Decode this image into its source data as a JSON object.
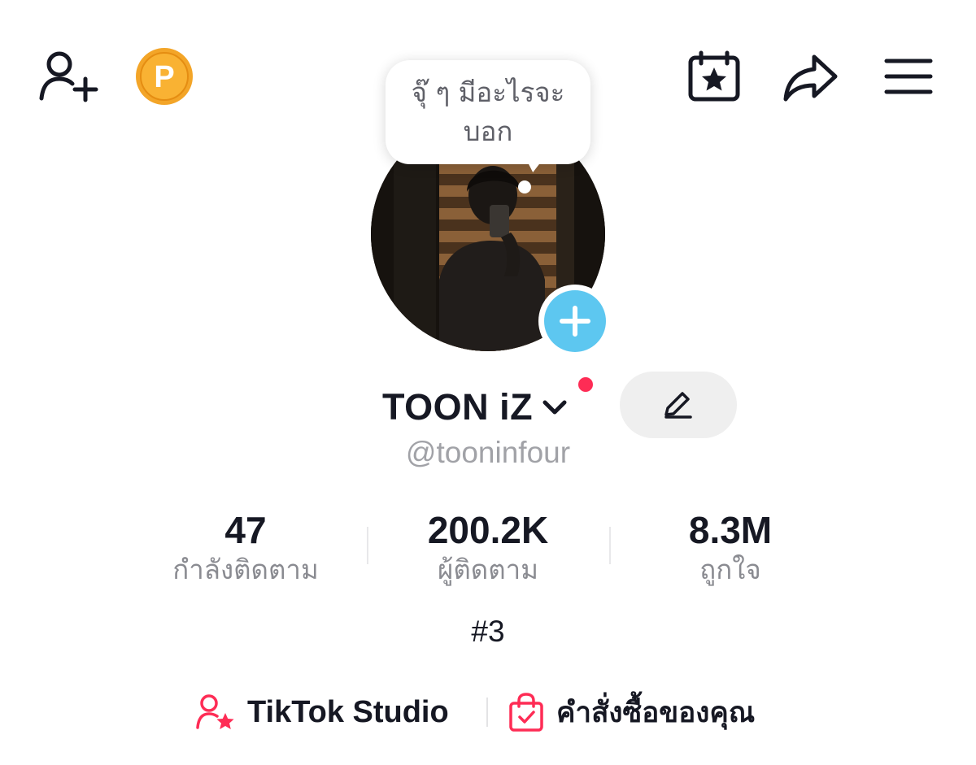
{
  "header": {
    "add_friend_icon": "person-plus-icon",
    "coin_icon": "coin-icon",
    "coin_letter": "P",
    "calendar_icon": "calendar-star-icon",
    "share_icon": "share-arrow-icon",
    "menu_icon": "hamburger-menu-icon"
  },
  "note": {
    "text": "จุ๊ ๆ มีอะไรจะบอก"
  },
  "profile": {
    "display_name": "TOON iZ",
    "username": "@tooninfour",
    "has_notification_dot": true,
    "edit_icon": "pencil-icon",
    "add_avatar_icon": "plus-icon"
  },
  "stats": {
    "following": {
      "value": "47",
      "label": "กำลังติดตาม"
    },
    "followers": {
      "value": "200.2K",
      "label": "ผู้ติดตาม"
    },
    "likes": {
      "value": "8.3M",
      "label": "ถูกใจ"
    }
  },
  "bio": "#3",
  "links": {
    "studio": {
      "label": "TikTok Studio",
      "icon": "person-star-icon"
    },
    "orders": {
      "label": "คำสั่งซื้อของคุณ",
      "icon": "shopping-bag-check-icon"
    }
  },
  "colors": {
    "accent_red": "#fe2c55",
    "add_blue": "#5dc7f0",
    "coin_orange": "#f7a21b"
  }
}
